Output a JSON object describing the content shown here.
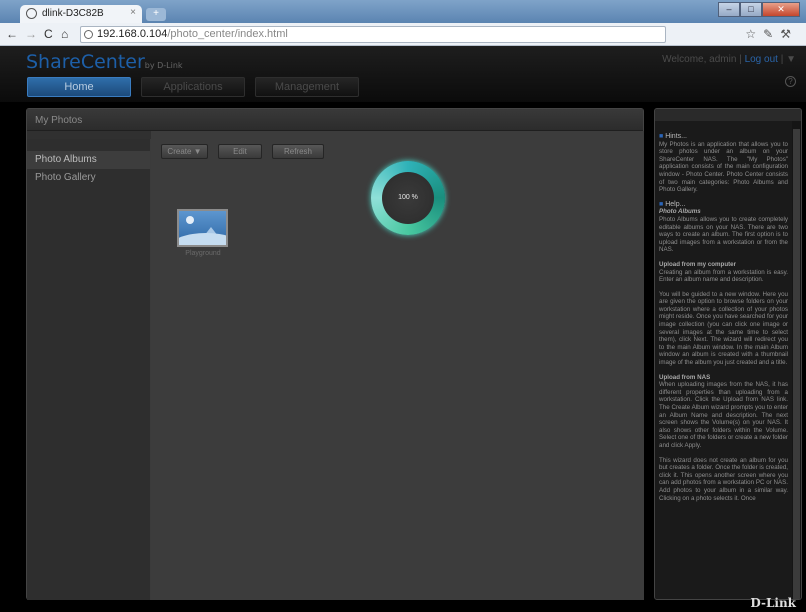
{
  "browser": {
    "tab_title": "dlink-D3C82B",
    "tab_close": "×",
    "new_tab": "+",
    "url_host": "192.168.0.104",
    "url_path": "/photo_center/index.html"
  },
  "header": {
    "logo": "ShareCenter",
    "logo_sub": "by D-Link",
    "welcome": "Welcome, admin |",
    "logout": "Log out",
    "nav": [
      "Home",
      "Applications",
      "Management"
    ]
  },
  "panel": {
    "title": "My Photos",
    "sidebar": [
      "Photo Albums",
      "Photo Gallery"
    ],
    "toolbar": {
      "create": "Create ▼",
      "edit": "Edit",
      "refresh": "Refresh"
    },
    "progress_label": "100 %",
    "progress_value": 100,
    "album_name": "Playground"
  },
  "help": {
    "hints_title": "Hints...",
    "hints_text": "My Photos is an application that allows you to store photos under an album on your ShareCenter NAS. The \"My Photos\" application consists of the main configuration window - Photo Center. Photo Center consists of two main categories: Photo Albums and Photo Gallery.",
    "help_title": "Help...",
    "albums_title": "Photo Albums",
    "albums_text": "Photo Albums allows you to create completely editable albums on your NAS. There are two ways to create an album. The first option is to upload images from a workstation or from the NAS.",
    "upload_computer_title": "Upload from my computer",
    "upload_computer_text": "Creating an album from a workstation is easy. Enter an album name and description.",
    "guided_text": "You will be guided to a new window. Here you are given the option to browse folders on your workstation where a collection of your photos might reside. Once you have searched for your image collection (you can click one image or several images at the same time to select them), click Next. The wizard will redirect you to the main Album window. In the main Album window an album is created with a thumbnail image of the album you just created and a title.",
    "upload_nas_title": "Upload from NAS",
    "upload_nas_text": "When uploading images from the NAS, it has different properties than uploading from a workstation. Click the Upload from NAS link. The Create Album wizard prompts you to enter an Album Name and description. The next screen shows the Volume(s) on your NAS. It also shows other folders within the Volume. Select one of the folders or create a new folder and click Apply.",
    "wizard_text": "This wizard does not create an album for you but creates a folder. Once the folder is created, click it. This opens another screen where you can add photos from a workstation PC or NAS. Add photos to your album in a similar way. Clicking on a photo selects it. Once"
  },
  "brand_footer": "D-Link"
}
